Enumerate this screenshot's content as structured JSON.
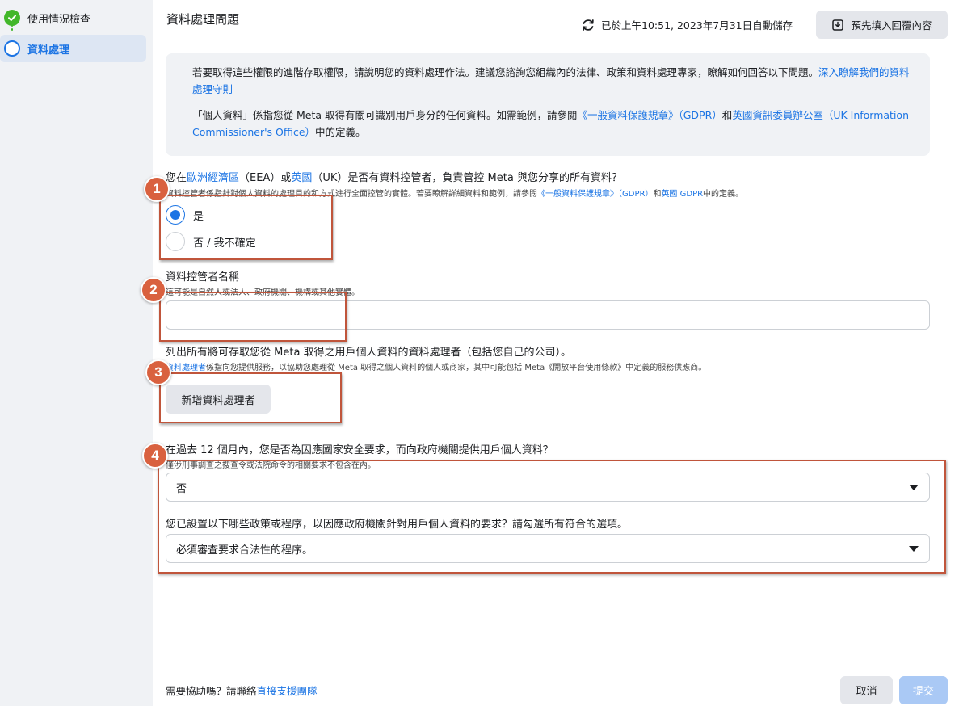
{
  "sidebar": {
    "steps": [
      {
        "label": "使用情況檢查",
        "status": "done"
      },
      {
        "label": "資料處理",
        "status": "current"
      }
    ]
  },
  "header": {
    "title": "資料處理問題",
    "autosave_text": "已於上午10:51, 2023年7月31日自動儲存",
    "prefill_label": "預先填入回覆內容"
  },
  "info": {
    "p1_text": "若要取得這些權限的進階存取權限，請說明您的資料處理作法。建議您諮詢您組織內的法律、政策和資料處理專家，瞭解如何回答以下問題。",
    "p1_link": "深入瞭解我們的資料處理守則",
    "p2_a": "「個人資料」係指您從 Meta 取得有關可識別用戶身分的任何資料。如需範例，請參閱",
    "p2_link1": "《一般資料保護規章》（GDPR）",
    "p2_b": "和",
    "p2_link2": "英國資訊委員辦公室（UK Information Commissioner's Office）",
    "p2_c": "中的定義。"
  },
  "q1": {
    "title_a": "您在",
    "title_link1": "歐洲經濟區",
    "title_b": "（EEA）或",
    "title_link2": "英國",
    "title_c": "（UK）是否有資料控管者，負責管控 Meta 與您分享的所有資料？",
    "sub_a": "資料控管者係指針對個人資料的處理目的和方式進行全面控管的實體。若要瞭解詳細資料和範例，請參閱",
    "sub_link1": "《一般資料保護規章》（GDPR）",
    "sub_b": "和",
    "sub_link2": "英國 GDPR",
    "sub_c": "中的定義。",
    "options": [
      "是",
      "否 / 我不確定"
    ],
    "selected": 0
  },
  "q2": {
    "title": "資料控管者名稱",
    "sub": "這可能是自然人或法人、政府機關、機構或其他實體。",
    "value": ""
  },
  "q3": {
    "title": "列出所有將可存取您從 Meta 取得之用戶個人資料的資料處理者（包括您自己的公司）。",
    "sub_link": "資料處理者",
    "sub_rest": "係指向您提供服務，以協助您處理從 Meta 取得之個人資料的個人或商家，其中可能包括 Meta《開放平台使用條款》中定義的服務供應商。",
    "button": "新增資料處理者"
  },
  "q4": {
    "title": "在過去 12 個月內，您是否為因應國家安全要求，而向政府機關提供用戶個人資料？",
    "sub": "僅涉刑事調查之搜查令或法院命令的相關要求不包含在內。",
    "select_value": "否",
    "q5_title": "您已設置以下哪些政策或程序，以因應政府機關針對用戶個人資料的要求？請勾選所有符合的選項。",
    "q5_value": "必須審查要求合法性的程序。"
  },
  "badges": [
    "1",
    "2",
    "3",
    "4"
  ],
  "footer": {
    "help_text": "需要協助嗎？請聯絡",
    "help_link": "直接支援團隊",
    "cancel": "取消",
    "submit": "提交"
  },
  "colors": {
    "accent": "#1b74e4",
    "annotation": "#c0553b",
    "success": "#42b72a"
  }
}
